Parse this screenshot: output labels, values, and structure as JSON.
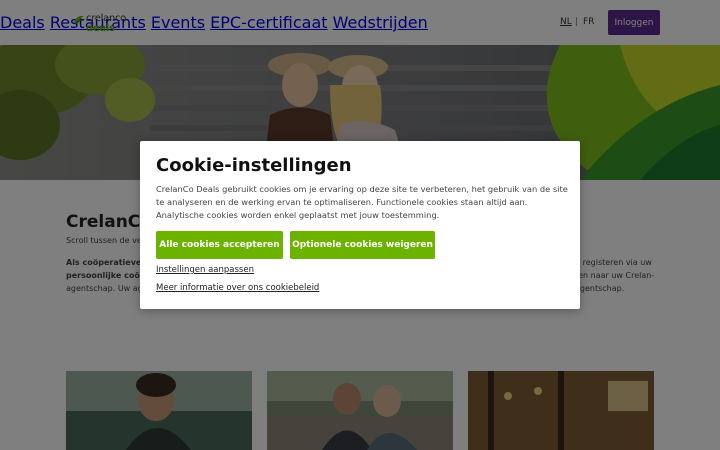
{
  "header": {
    "logo_top": "crelanco",
    "logo_bottom": "deals",
    "nav": [
      "Deals",
      "Restaurants",
      "Events",
      "EPC-certificaat",
      "Wedstrijden"
    ],
    "lang_nl": "NL",
    "lang_sep": "|",
    "lang_fr": "FR",
    "login_label": "Inloggen"
  },
  "page": {
    "title_visible": "CrelanCo",
    "subtitle_visible": "Scroll tussen de vele",
    "para_left_bold": "Als coöperatieve a",
    "para_left_bold2": "persoonlijke coöpe",
    "para_left_rest": "agentschap. Uw age",
    "para_right_1": "u registeren via uw",
    "para_right_2": "ren naar uw Crelan-",
    "para_right_3": "agentschap."
  },
  "cookie_modal": {
    "title": "Cookie-instellingen",
    "text": "CrelanCo Deals gebruikt cookies om je ervaring op deze site te verbeteren, het gebruik van de site te analyseren en de werking ervan te optimaliseren. Functionele cookies staan altijd aan. Analytische cookies worden enkel geplaatst met jouw toestemming.",
    "accept_label": "Alle cookies accepteren",
    "refuse_label": "Optionele cookies weigeren",
    "settings_link": "Instellingen aanpassen",
    "policy_link": "Meer informatie over ons cookiebeleid"
  },
  "colors": {
    "brand_green": "#6cb300",
    "brand_purple": "#5b2d8e",
    "overlay": "rgba(0,0,0,0.5)"
  }
}
